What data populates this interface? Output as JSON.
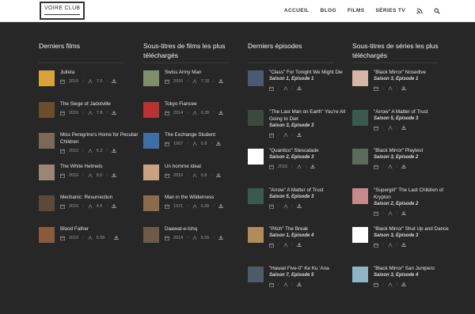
{
  "header": {
    "logo_text": "VOIRE CLUB",
    "nav": [
      "ACCUEIL",
      "BLOG",
      "FILMS",
      "SÉRIES TV"
    ]
  },
  "columns": [
    {
      "title": "Derniers films",
      "items": [
        {
          "title": "Julieta",
          "year": "2016",
          "rating": "7.0",
          "color": "#d9a23b"
        },
        {
          "title": "The Siege of Jadotville",
          "year": "2016",
          "rating": "7.8",
          "color": "#6b4d2e"
        },
        {
          "title": "Miss Peregrine's Home for Peculiar Children",
          "year": "2016",
          "rating": "6.3",
          "color": "#7a6a55"
        },
        {
          "title": "The White Helmets",
          "year": "2016",
          "rating": "8.0",
          "color": "#9a8673"
        },
        {
          "title": "Mechanic: Resurrection",
          "year": "2016",
          "rating": "4.5",
          "color": "#5a4a3d"
        },
        {
          "title": "Blood Father",
          "year": "2016",
          "rating": "6.55",
          "color": "#8a5b3a"
        }
      ]
    },
    {
      "title": "Sous-titres de films les plus téléchargés",
      "items": [
        {
          "title": "Swiss Army Man",
          "year": "2016",
          "rating": "7.15",
          "color": "#7e8f6c"
        },
        {
          "title": "Tokyo Fiancee",
          "year": "2014",
          "rating": "6.35",
          "color": "#b8322f"
        },
        {
          "title": "The Exchange Student",
          "year": "1967",
          "rating": "6.8",
          "color": "#3d6fa6"
        },
        {
          "title": "Un homme ideal",
          "year": "2015",
          "rating": "6.8",
          "color": "#caa27d"
        },
        {
          "title": "Man in the Wilderness",
          "year": "1971",
          "rating": "6.55",
          "color": "#8c6b4a"
        },
        {
          "title": "Daawat-e-Ishq",
          "year": "2014",
          "rating": "6.55",
          "color": "#6d5a48"
        }
      ]
    },
    {
      "title": "Derniers épisodes",
      "items": [
        {
          "title": "\"Class\" For Tonight We Might Die",
          "sub": "Saison 1, Episode 1",
          "color": "#4a5a73"
        },
        {
          "title": "\"The Last Man on Earth\" You're All Going to Diet",
          "sub": "Saison 3, Episode 3",
          "color": "#3b4a3b"
        },
        {
          "title": "\"Quantico\" Stescalade",
          "sub": "Saison 2, Episode 3",
          "year": "2016",
          "blank": true
        },
        {
          "title": "\"Arrow\" A Matter of Trust",
          "sub": "Saison 5, Episode 3",
          "color": "#3b5a4f"
        },
        {
          "title": "\"Pitch\" The Break",
          "sub": "Saison 1, Episode 4",
          "color": "#b18b5a"
        },
        {
          "title": "\"Hawaii Five-0\" Ke Ku 'Ana",
          "sub": "Saison 7, Episode 5",
          "color": "#4d5a68"
        }
      ]
    },
    {
      "title": "Sous-titres de séries les plus téléchargés",
      "items": [
        {
          "title": "\"Black Mirror\" Nosedive",
          "sub": "Saison 3, Episode 1",
          "color": "#d7b6a8"
        },
        {
          "title": "\"Arrow\" A Matter of Trust",
          "sub": "Saison 5, Episode 3",
          "color": "#3b5a4f"
        },
        {
          "title": "\"Black Mirror\" Playtest",
          "sub": "Saison 3, Episode 2",
          "color": "#5b6a5b"
        },
        {
          "title": "\"Supergirl\" The Last Children of Krypton",
          "sub": "Saison 2, Episode 2",
          "color": "#c68a8a"
        },
        {
          "title": "\"Black Mirror\" Shut Up and Dance",
          "sub": "Saison 3, Episode 3",
          "blank": true
        },
        {
          "title": "\"Black Mirror\" San Junipero",
          "sub": "Saison 3, Episode 4",
          "color": "#8fb4c6"
        }
      ]
    }
  ]
}
